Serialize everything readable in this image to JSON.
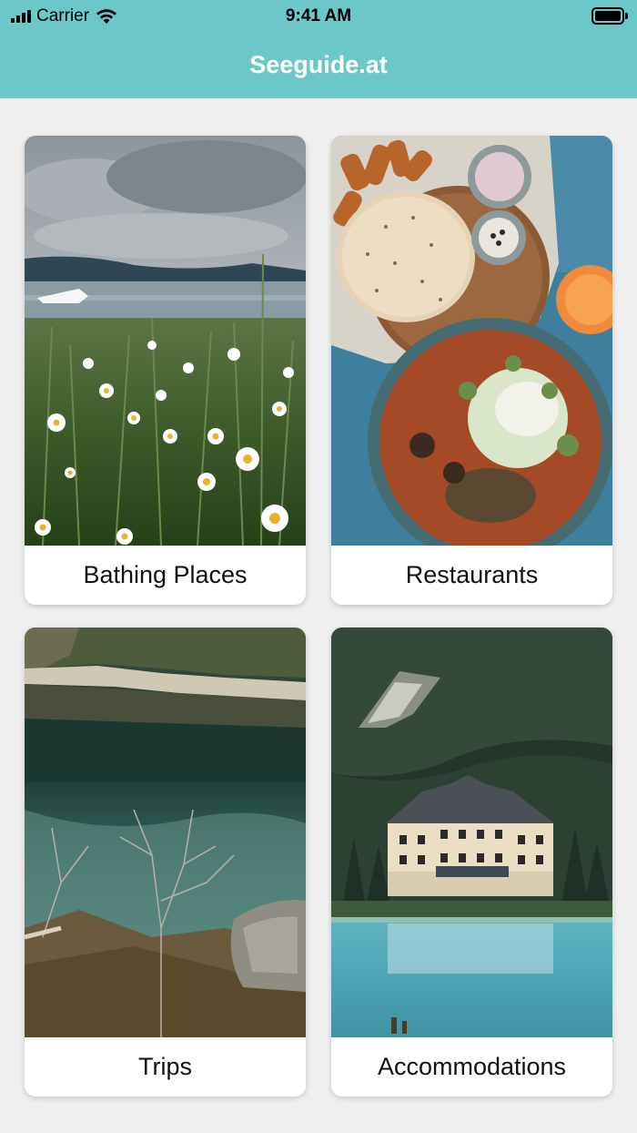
{
  "status_bar": {
    "carrier": "Carrier",
    "time": "9:41 AM",
    "icons": [
      "signal-icon",
      "wifi-icon",
      "battery-icon"
    ]
  },
  "header": {
    "title": "Seeguide.at"
  },
  "colors": {
    "header_bg": "#6cc7c9",
    "page_bg": "#efefef",
    "card_bg": "#ffffff"
  },
  "categories": [
    {
      "label": "Bathing Places",
      "image": "lake-meadow-daisies-photo"
    },
    {
      "label": "Restaurants",
      "image": "food-table-photo"
    },
    {
      "label": "Trips",
      "image": "mountain-lake-reflection-photo"
    },
    {
      "label": "Accommodations",
      "image": "lakeside-hotel-photo"
    }
  ]
}
